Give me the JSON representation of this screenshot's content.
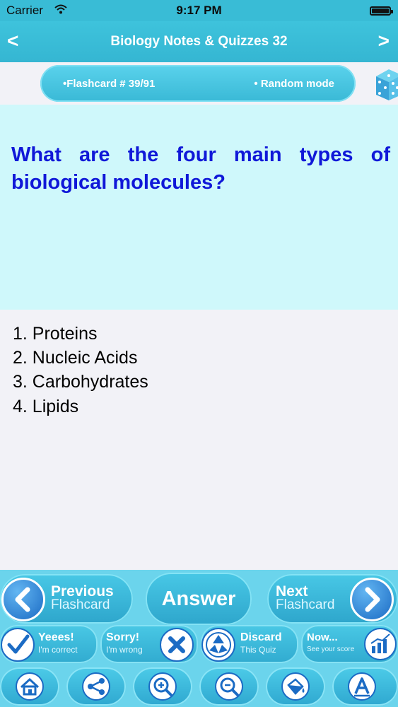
{
  "status_bar": {
    "carrier": "Carrier",
    "time": "9:17 PM"
  },
  "nav": {
    "title": "Biology Notes & Quizzes 32",
    "back": "<",
    "forward": ">"
  },
  "info": {
    "counter": "•Flashcard #  39/91",
    "mode": "• Random mode"
  },
  "question": "What are the four main types of biological molecules?",
  "answer_lines": [
    "1. Proteins",
    "2. Nucleic Acids",
    "3. Carbohydrates",
    "4. Lipids"
  ],
  "controls": {
    "previous": {
      "label": "Previous",
      "sub": "Flashcard"
    },
    "answer": "Answer",
    "next": {
      "label": "Next",
      "sub": "Flashcard"
    },
    "yes": {
      "label": "Yeees!",
      "sub": "I'm correct"
    },
    "sorry": {
      "label": "Sorry!",
      "sub": "I'm wrong"
    },
    "discard": {
      "label": "Discard",
      "sub": "This Quiz"
    },
    "score": {
      "label": "Now...",
      "sub": "See your score"
    }
  },
  "toolbar": [
    "home-icon",
    "share-icon",
    "zoom-in-icon",
    "zoom-out-icon",
    "bucket-icon",
    "font-icon"
  ],
  "colors": {
    "accent": "#39bcd6",
    "question_bg": "#cff8fb",
    "question_text": "#1018d8",
    "button_blue": "#1b6bc4"
  }
}
